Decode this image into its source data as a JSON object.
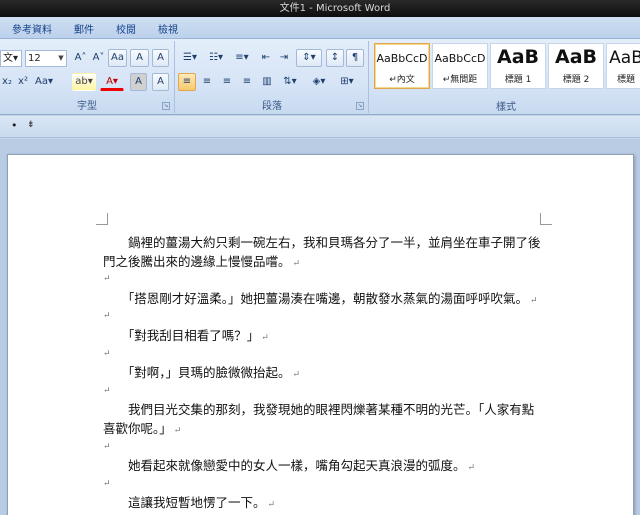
{
  "window": {
    "title": "文件1 - Microsoft Word"
  },
  "tabs": [
    "參考資料",
    "郵件",
    "校閱",
    "檢視"
  ],
  "font_group": {
    "label": "字型",
    "font_name": "文▾",
    "font_size": "12",
    "row1": [
      "A˄",
      "A˅",
      "Aa",
      "A",
      "A"
    ],
    "row2": [
      "x₂",
      "x²",
      "Aa▾",
      "ab▾",
      "A▾",
      "A",
      "A"
    ]
  },
  "paragraph_group": {
    "label": "段落",
    "row1": [
      "☰▾",
      "☷▾",
      "≡▾",
      "⇤",
      "⇥",
      "⇕▾",
      "↕",
      "¶"
    ],
    "row2": [
      "≡",
      "≡",
      "≡",
      "≡",
      "▥",
      "⇅▾",
      "◈▾",
      "⊞▾"
    ]
  },
  "styles_group": {
    "label": "樣式",
    "items": [
      {
        "sample": "AaBbCcD",
        "name": "↵內文",
        "selected": true
      },
      {
        "sample": "AaBbCcD",
        "name": "↵無間距",
        "selected": false
      },
      {
        "sample": "AaB",
        "name": "標題 1",
        "selected": false
      },
      {
        "sample": "AaB",
        "name": "標題 2",
        "selected": false
      },
      {
        "sample": "AaB",
        "name": "標題",
        "selected": false
      }
    ]
  },
  "quick_access": {
    "bullet": "•",
    "more": "⇟"
  },
  "paragraph_mark": "↵",
  "document": {
    "lines": [
      "　　鍋裡的薑湯大約只剩一碗左右，我和貝瑪各分了一半，並肩坐在車子開了後",
      "門之後騰出來的邊緣上慢慢品嚐。",
      "",
      "　　「搭恩剛才好溫柔。」她把薑湯湊在嘴邊，朝散發水蒸氣的湯面呼呼吹氣。",
      "",
      "　　「對我刮目相看了嗎？」",
      "",
      "　　「對啊，」貝瑪的臉微微抬起。",
      "",
      "　　我們目光交集的那刻，我發現她的眼裡閃爍著某種不明的光芒。「人家有點",
      "喜歡你呢。」",
      "",
      "　　她看起來就像戀愛中的女人一樣，嘴角勾起天真浪漫的弧度。",
      "",
      "　　這讓我短暫地愣了一下。"
    ]
  }
}
